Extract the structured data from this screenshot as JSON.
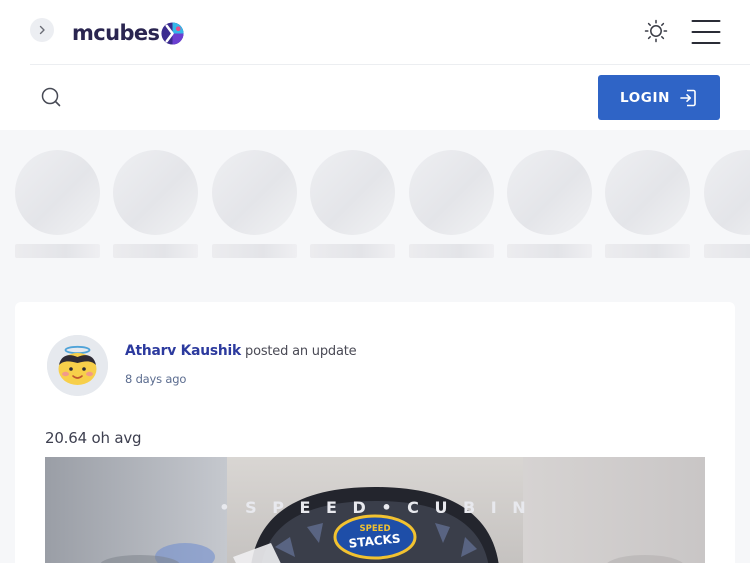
{
  "header": {
    "logo_text": "mcubes",
    "login_label": "LOGIN",
    "icons": {
      "expand": "chevron-right-icon",
      "theme": "sun-icon",
      "menu": "hamburger-menu-icon",
      "search": "search-icon",
      "login": "login-icon"
    }
  },
  "stories": {
    "count": 8,
    "state": "loading"
  },
  "post": {
    "author": "Atharv Kaushik",
    "action": "posted an update",
    "timestamp": "8 days ago",
    "text": "20.64 oh avg",
    "image_text": [
      "SPEED",
      "STACKS"
    ]
  },
  "colors": {
    "brand_dark": "#2a2550",
    "login_button": "#2f64c6",
    "author_link": "#2c3a9e",
    "page_background": "#f6f7f9"
  }
}
